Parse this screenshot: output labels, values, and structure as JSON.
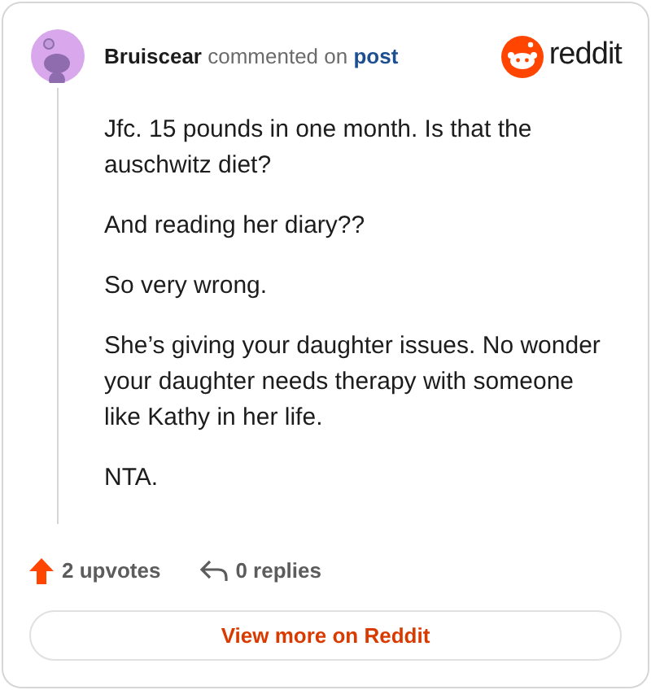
{
  "header": {
    "author": "Bruiscear",
    "action": "commented on",
    "target": "post",
    "brand": "reddit"
  },
  "comment": {
    "paragraphs": [
      "Jfc. 15 pounds in one month. Is that the auschwitz diet?",
      "And reading her diary??",
      "So very wrong.",
      "She’s giving your daughter issues. No wonder your daughter needs therapy with someone like Kathy in her life.",
      "NTA."
    ]
  },
  "footer": {
    "upvotes": "2 upvotes",
    "replies": "0 replies",
    "button": "View more on Reddit"
  }
}
